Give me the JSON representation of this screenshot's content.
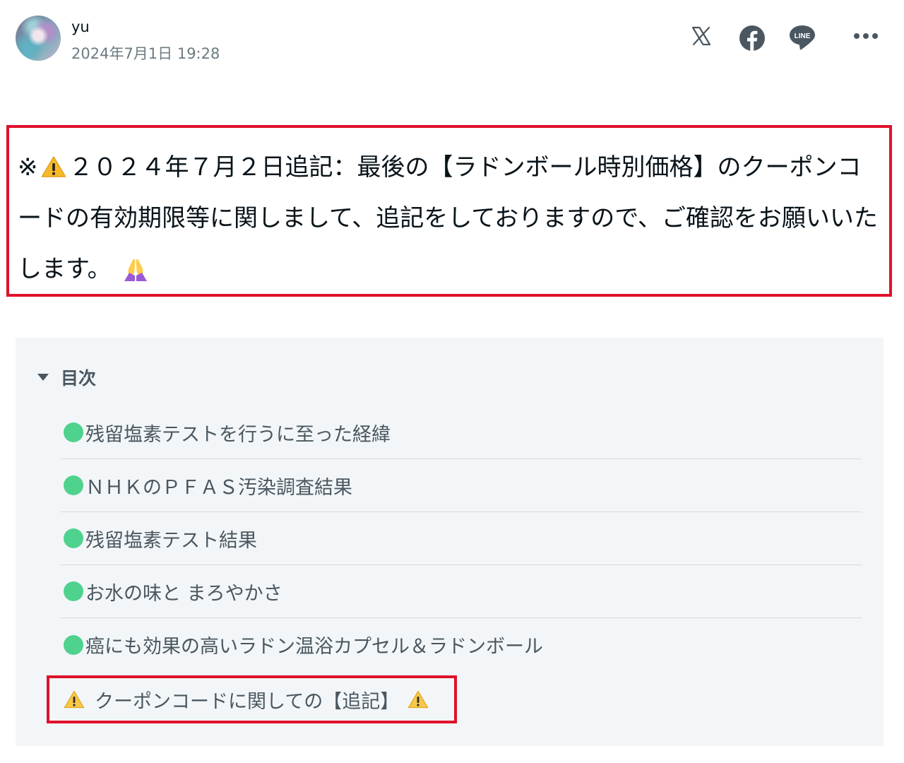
{
  "author": {
    "name": "yu",
    "date": "2024年7月1日 19:28"
  },
  "share": {
    "x_icon": "x-logo-icon",
    "facebook_icon": "facebook-icon",
    "line_icon": "line-icon",
    "line_label": "LINE",
    "more_icon": "more-dots-icon"
  },
  "notice": {
    "prefix": "※",
    "text": "２０２４年７月２日追記：最後の【ラドンボール時別価格】のクーポンコードの有効期限等に関しまして、追記をしておりますので、ご確認をお願いいたします。",
    "warning_icon": "warning-icon",
    "end_icon": "praying-hands-icon"
  },
  "toc": {
    "title": "目次",
    "items": [
      {
        "label": "残留塩素テストを行うに至った経緯"
      },
      {
        "label": "ＮＨＫのＰＦＡＳ汚染調査結果"
      },
      {
        "label": "残留塩素テスト結果"
      },
      {
        "label": "お水の味と まろやかさ"
      },
      {
        "label": "癌にも効果の高いラドン温浴カプセル＆ラドンボール"
      }
    ],
    "highlighted": {
      "label": "クーポンコードに関しての【追記】"
    }
  },
  "colors": {
    "highlight_border": "#e0112a",
    "toc_background": "#f3f6f8",
    "bullet": "#4fd28e",
    "text": "#08131a",
    "muted_text": "#4a5760"
  }
}
